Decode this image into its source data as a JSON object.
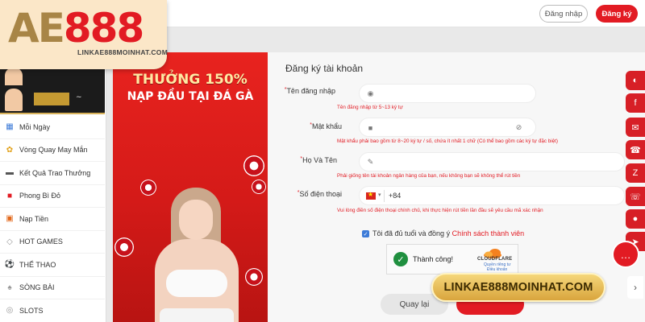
{
  "header": {
    "login_label": "Đăng nhập",
    "register_label": "Đăng ký"
  },
  "logo": {
    "brand_part1": "AE",
    "brand_part2": "888",
    "link_text": "LINKAE888MOINHAT.COM"
  },
  "sidebar": {
    "menu": [
      {
        "label": "Mỗi Ngày",
        "icon": "calendar-icon"
      },
      {
        "label": "Vòng Quay May Mắn",
        "icon": "wheel-icon"
      },
      {
        "label": "Kết Quả Trao Thưởng",
        "icon": "car-icon"
      },
      {
        "label": "Phong Bì Đỏ",
        "icon": "red-envelope-icon"
      },
      {
        "label": "Nạp Tiền",
        "icon": "deposit-icon"
      },
      {
        "label": "HOT GAMES",
        "icon": "diamond-icon"
      },
      {
        "label": "THỂ THAO",
        "icon": "soccer-icon"
      },
      {
        "label": "SÒNG BÀI",
        "icon": "casino-icon"
      },
      {
        "label": "SLOTS",
        "icon": "slots-icon"
      }
    ]
  },
  "banner": {
    "title": "THƯỞNG 150%",
    "subtitle": "NẠP ĐẦU TẠI ĐÁ GÀ"
  },
  "form": {
    "title": "Đăng ký tài khoản",
    "username": {
      "label": "Tên đăng nhập",
      "value": "",
      "hint": "Tên đăng nhập từ 5~13 ký tự"
    },
    "password": {
      "label": "Mật khẩu",
      "value": "",
      "hint": "Mật khẩu phải bao gồm từ 8~20 ký tự / số, chứa ít nhất 1 chữ (Có thể bao gồm các ký tự đặc biệt)"
    },
    "fullname": {
      "label": "Họ Và Tên",
      "value": "",
      "hint": "Phải giống tên tài khoản ngân hàng của bạn, nếu không bạn sẽ không thể rút tiền"
    },
    "phone": {
      "label": "Số điện thoại",
      "country_code": "+84",
      "value": "",
      "hint": "Vui lòng điền số điện thoại chính chủ, khi thực hiện rút tiền lần đầu sẽ yêu cầu mã xác nhận"
    },
    "agree": {
      "checked": true,
      "text": "Tôi đã đủ tuổi và đồng ý",
      "link": "Chính sách thành viên"
    },
    "captcha": {
      "status": "Thành công!",
      "brand": "CLOUDFLARE",
      "privacy": "Quyền riêng tư",
      "terms": "Điều khoản"
    },
    "back_label": "Quay lại",
    "submit_label": ""
  },
  "watermark": "LINKAE888MOINHAT.COM",
  "social": [
    "support-icon",
    "facebook-icon",
    "messenger-icon",
    "phone-icon",
    "zalo-icon",
    "phone-icon",
    "call-icon",
    "telegram-icon",
    "skype-icon"
  ],
  "colors": {
    "accent": "#e21b23",
    "gold": "#a88546",
    "banner_red": "#d41a18"
  }
}
